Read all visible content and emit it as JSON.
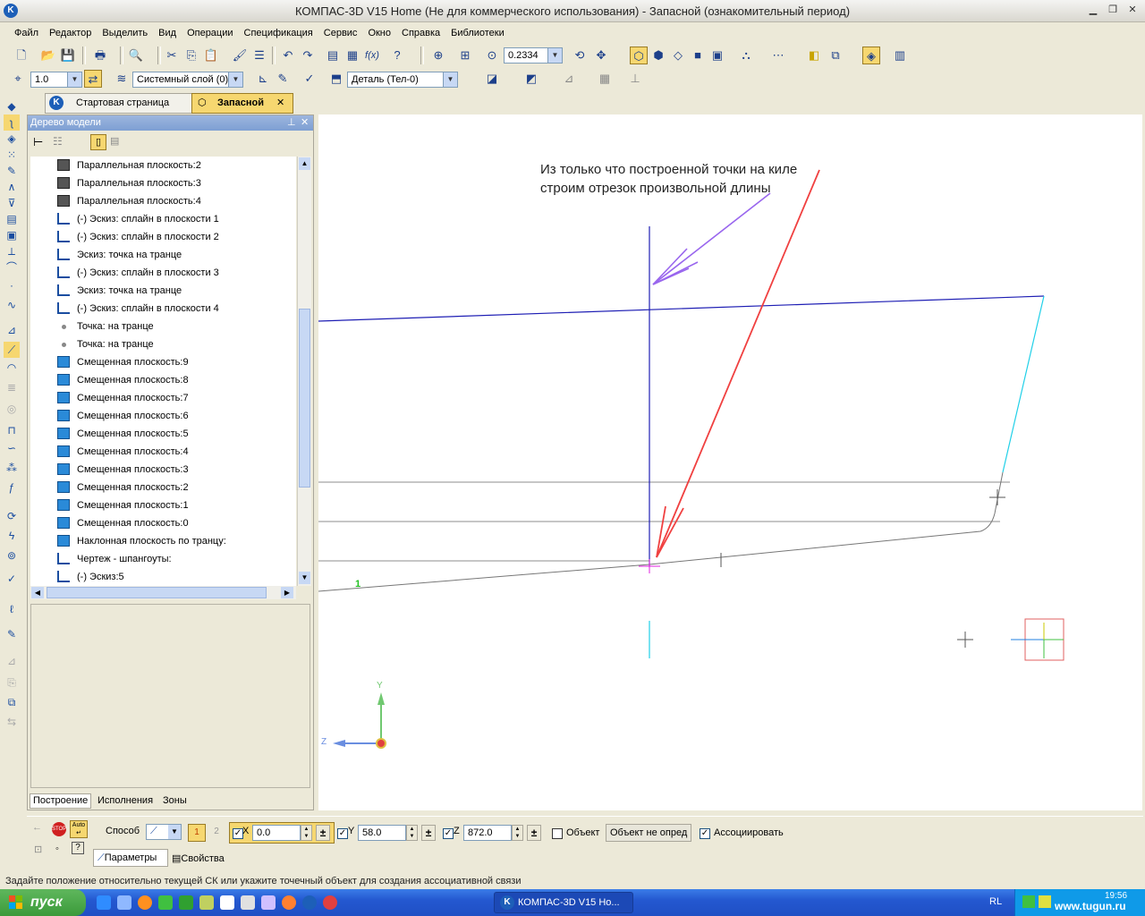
{
  "window": {
    "title": "КОМПАС-3D V15 Home (Не для коммерческого использования) - Запасной (ознакомительный период)",
    "app_icon": "kompas-icon"
  },
  "menu": [
    "Файл",
    "Редактор",
    "Выделить",
    "Вид",
    "Операции",
    "Спецификация",
    "Сервис",
    "Окно",
    "Справка",
    "Библиотеки"
  ],
  "toolbar1": {
    "zoom_value": "0.2334"
  },
  "toolbar2": {
    "step_value": "1.0",
    "layer_value": "Системный слой (0)",
    "detail_value": "Деталь (Тел-0)"
  },
  "tabs": [
    {
      "label": "Стартовая страница",
      "active": false
    },
    {
      "label": "Запасной",
      "active": true
    }
  ],
  "tree_panel": {
    "title": "Дерево модели",
    "items": [
      {
        "label": "Параллельная плоскость:2",
        "icon": "plane-gray-icon"
      },
      {
        "label": "Параллельная плоскость:3",
        "icon": "plane-gray-icon"
      },
      {
        "label": "Параллельная плоскость:4",
        "icon": "plane-gray-icon"
      },
      {
        "label": "(-) Эскиз: сплайн в плоскости 1",
        "icon": "sketch-icon"
      },
      {
        "label": "(-) Эскиз: сплайн в плоскости 2",
        "icon": "sketch-icon"
      },
      {
        "label": "Эскиз: точка на транце",
        "icon": "sketch-icon"
      },
      {
        "label": "(-) Эскиз: сплайн в плоскости 3",
        "icon": "sketch-icon"
      },
      {
        "label": "Эскиз: точка на транце",
        "icon": "sketch-icon"
      },
      {
        "label": "(-) Эскиз: сплайн  в плоскости 4",
        "icon": "sketch-icon"
      },
      {
        "label": "Точка: на транце",
        "icon": "point-icon"
      },
      {
        "label": "Точка: на транце",
        "icon": "point-icon"
      },
      {
        "label": "Смещенная плоскость:9",
        "icon": "plane-blue-icon"
      },
      {
        "label": "Смещенная плоскость:8",
        "icon": "plane-blue-icon"
      },
      {
        "label": "Смещенная плоскость:7",
        "icon": "plane-blue-icon"
      },
      {
        "label": "Смещенная плоскость:6",
        "icon": "plane-blue-icon"
      },
      {
        "label": "Смещенная плоскость:5",
        "icon": "plane-blue-icon"
      },
      {
        "label": "Смещенная плоскость:4",
        "icon": "plane-blue-icon"
      },
      {
        "label": "Смещенная плоскость:3",
        "icon": "plane-blue-icon"
      },
      {
        "label": "Смещенная плоскость:2",
        "icon": "plane-blue-icon"
      },
      {
        "label": "Смещенная плоскость:1",
        "icon": "plane-blue-icon"
      },
      {
        "label": "Смещенная плоскость:0",
        "icon": "plane-blue-icon"
      },
      {
        "label": "Наклонная плоскость по транцу:",
        "icon": "plane-blue-icon"
      },
      {
        "label": "Чертеж -  шпангоуты:",
        "icon": "sketch-icon"
      },
      {
        "label": "(-) Эскиз:5",
        "icon": "sketch-icon"
      }
    ],
    "bottom_tabs": [
      "Построение",
      "Исполнения",
      "Зоны"
    ]
  },
  "canvas": {
    "annotation_line1": "Из только что построенной точки на киле",
    "annotation_line2": "строим отрезок произвольной длины",
    "marker_label": "1",
    "axis_y": "Y",
    "axis_z": "Z"
  },
  "propbar": {
    "method_label": "Способ",
    "x_value": "0.0",
    "y_label": "Y",
    "y_value": "58.0",
    "z_label": "Z",
    "z_value": "872.0",
    "object_label": "Объект",
    "object_value": "Объект не опред",
    "associate_label": "Ассоциировать",
    "tab_params": "Параметры",
    "tab_props": "Свойства"
  },
  "status": "Задайте положение относительно текущей СК или укажите точечный объект для создания ассоциативной связи",
  "taskbar": {
    "start_label": "пуск",
    "task_item": "КОМПАС-3D V15 Ho...",
    "lang": "RL",
    "clock": "19:56",
    "watermark": "www.tugun.ru"
  },
  "colors": {
    "annotation_arrow": "#9966ee",
    "red_arrow": "#f04040",
    "blue_line": "#1e1eb4",
    "cyan_line": "#20d0e8"
  }
}
